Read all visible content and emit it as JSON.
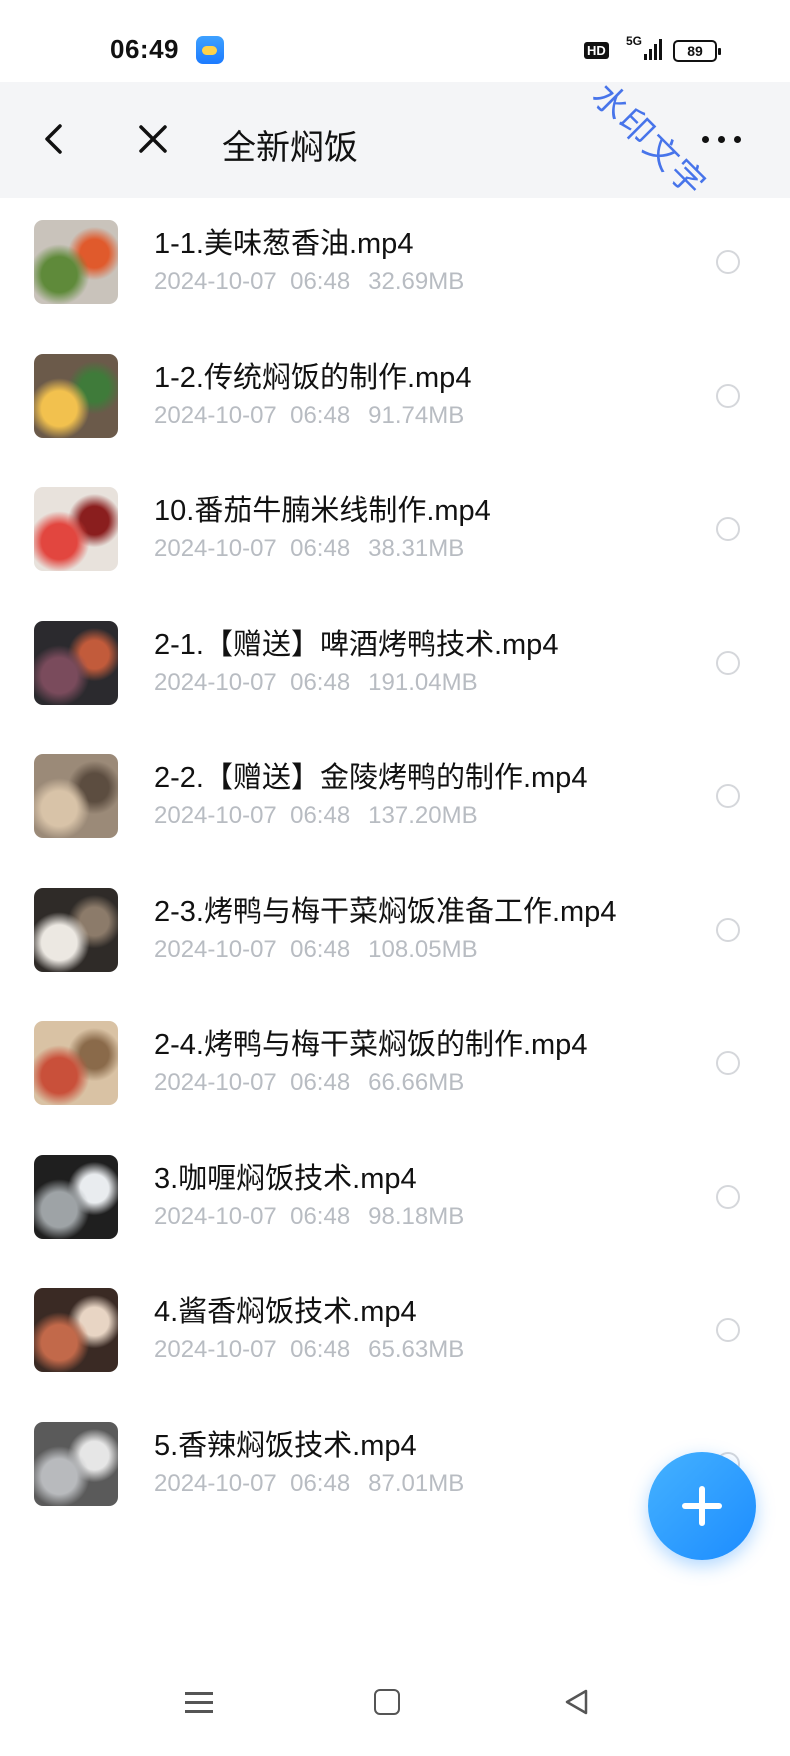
{
  "status_bar": {
    "time": "06:49",
    "hd": "HD",
    "signal": "5G",
    "battery": "89"
  },
  "app_bar": {
    "title": "全新焖饭"
  },
  "watermark": "水印文字",
  "files": [
    {
      "name": "1-1.美味葱香油.mp4",
      "date": "2024-10-07  06:48",
      "size": "32.69MB",
      "thumb_colors": [
        "#c9c3bb",
        "#5f8a3a",
        "#e05a2c"
      ]
    },
    {
      "name": "1-2.传统焖饭的制作.mp4",
      "date": "2024-10-07  06:48",
      "size": "91.74MB",
      "thumb_colors": [
        "#6b5a4a",
        "#f2c14e",
        "#3f7b3a"
      ]
    },
    {
      "name": "10.番茄牛腩米线制作.mp4",
      "date": "2024-10-07  06:48",
      "size": "38.31MB",
      "thumb_colors": [
        "#e8e2dc",
        "#e2463f",
        "#8a1e1e"
      ]
    },
    {
      "name": "2-1.【赠送】啤酒烤鸭技术.mp4",
      "date": "2024-10-07  06:48",
      "size": "191.04MB",
      "thumb_colors": [
        "#2b2a2e",
        "#7a4b5c",
        "#c25b3b"
      ]
    },
    {
      "name": "2-2.【赠送】金陵烤鸭的制作.mp4",
      "date": "2024-10-07  06:48",
      "size": "137.20MB",
      "thumb_colors": [
        "#9b8a78",
        "#d8c3a8",
        "#5c4d40"
      ]
    },
    {
      "name": "2-3.烤鸭与梅干菜焖饭准备工作.mp4",
      "date": "2024-10-07  06:48",
      "size": "108.05MB",
      "thumb_colors": [
        "#2f2b28",
        "#ece8e2",
        "#8c7b6a"
      ]
    },
    {
      "name": "2-4.烤鸭与梅干菜焖饭的制作.mp4",
      "date": "2024-10-07  06:48",
      "size": "66.66MB",
      "thumb_colors": [
        "#d9c2a4",
        "#c9503a",
        "#8a6a4a"
      ]
    },
    {
      "name": "3.咖喱焖饭技术.mp4",
      "date": "2024-10-07  06:48",
      "size": "98.18MB",
      "thumb_colors": [
        "#1f1f1f",
        "#9ea3a6",
        "#e9ecef"
      ]
    },
    {
      "name": "4.酱香焖饭技术.mp4",
      "date": "2024-10-07  06:48",
      "size": "65.63MB",
      "thumb_colors": [
        "#3a2a24",
        "#c2694a",
        "#e8d5c4"
      ]
    },
    {
      "name": "5.香辣焖饭技术.mp4",
      "date": "2024-10-07  06:48",
      "size": "87.01MB",
      "thumb_colors": [
        "#5a5a5a",
        "#b8babd",
        "#e6e6e6"
      ]
    }
  ],
  "colors": {
    "accent": "#1c8cff",
    "meta_text": "#b8bcc2",
    "app_bar_bg": "#f4f5f7"
  },
  "icons": {
    "back": "chevron-left-icon",
    "close": "close-icon",
    "more": "more-dots-icon",
    "add": "plus-icon",
    "nav_menu": "menu-icon",
    "nav_home": "home-square-icon",
    "nav_back": "triangle-back-icon"
  }
}
